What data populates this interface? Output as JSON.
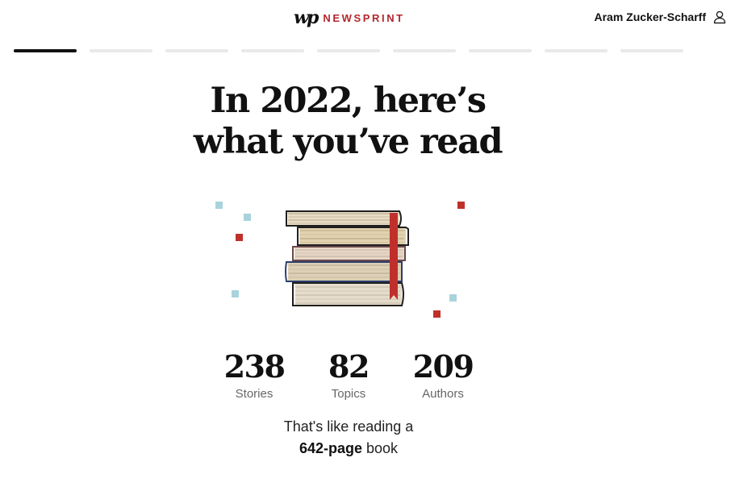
{
  "header": {
    "logo": "wp",
    "brand": "NEWSPRINT",
    "user_name": "Aram Zucker-Scharff",
    "user_icon": "person-icon"
  },
  "progress": {
    "total_steps": 9,
    "current_step": 1
  },
  "headline": {
    "line1": "In 2022, here’s",
    "line2": "what you’ve read"
  },
  "illustration": {
    "subject": "book-stack-icon",
    "confetti_colors": [
      "#a9d3dc",
      "#c0302b"
    ]
  },
  "stats": [
    {
      "value": "238",
      "label": "Stories"
    },
    {
      "value": "82",
      "label": "Topics"
    },
    {
      "value": "209",
      "label": "Authors"
    }
  ],
  "summary": {
    "prefix": "That's like reading a",
    "highlight": "642-page",
    "suffix": "book"
  },
  "colors": {
    "accent": "#b3282d",
    "progress_active": "#111111",
    "progress_inactive": "#e9e9e9"
  }
}
